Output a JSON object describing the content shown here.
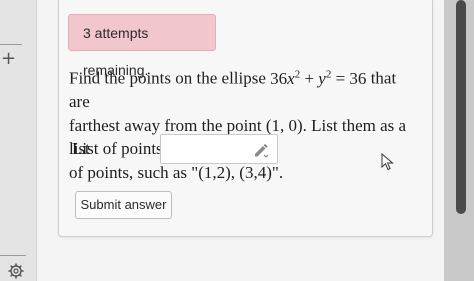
{
  "alert": {
    "text": "3 attempts remaining."
  },
  "question": {
    "line1_a": "Find the points on the ellipse ",
    "eq_36": "36",
    "eq_x": "x",
    "eq_x_exp": "2",
    "eq_plus": " + ",
    "eq_y": "y",
    "eq_y_exp": "2",
    "eq_rest": " = 36",
    "line1_b": " that are",
    "line2": "farthest away from the point (1, 0). List them as a list",
    "line3": "of points, such as \"(1,2), (3,4)\"."
  },
  "answer": {
    "label": "List of points:",
    "value": ""
  },
  "submit": {
    "label": "Submit answer"
  },
  "icons": {
    "rail_plus": "plus-icon",
    "rail_settings": "gear-icon",
    "input_tool": "pencil-icon",
    "pointer": "mouse-cursor-icon"
  },
  "colors": {
    "alert_bg": "#f2c6cd",
    "scroll_thumb": "#4a4a4a"
  }
}
